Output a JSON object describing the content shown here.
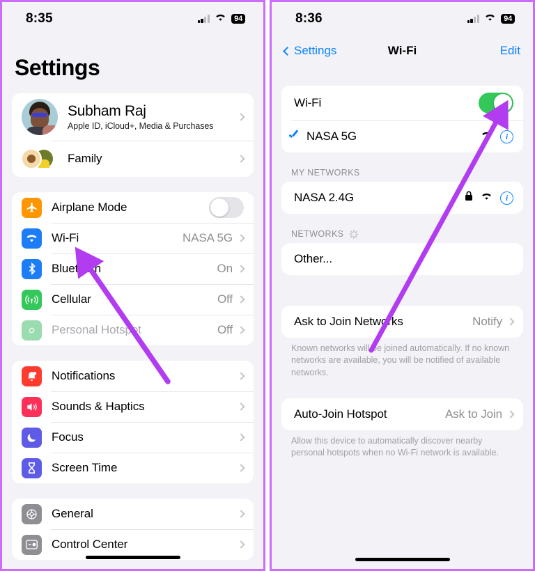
{
  "meta": {
    "accent_purple": "#cb6cfb",
    "ios_blue": "#0a84ff",
    "toggle_green": "#34c759"
  },
  "left_phone": {
    "status": {
      "time": "8:35",
      "battery": "94",
      "cellular_icon": "signal-bars-icon",
      "wifi_icon": "wifi-icon"
    },
    "title": "Settings",
    "profile": {
      "name": "Subham Raj",
      "subtitle": "Apple ID, iCloud+, Media & Purchases",
      "family_label": "Family"
    },
    "group_connectivity": [
      {
        "label": "Airplane Mode",
        "icon": "airplane-icon",
        "value": "",
        "control": "toggle-off"
      },
      {
        "label": "Wi-Fi",
        "icon": "wifi-icon",
        "value": "NASA 5G",
        "control": "chevron"
      },
      {
        "label": "Bluetooth",
        "icon": "bluetooth-icon",
        "value": "On",
        "control": "chevron"
      },
      {
        "label": "Cellular",
        "icon": "cellular-icon",
        "value": "Off",
        "control": "chevron"
      },
      {
        "label": "Personal Hotspot",
        "icon": "hotspot-icon",
        "value": "Off",
        "control": "chevron",
        "disabled": true
      }
    ],
    "group_alerts": [
      {
        "label": "Notifications",
        "icon": "notifications-icon",
        "value": "",
        "control": "chevron"
      },
      {
        "label": "Sounds & Haptics",
        "icon": "sounds-icon",
        "value": "",
        "control": "chevron"
      },
      {
        "label": "Focus",
        "icon": "focus-icon",
        "value": "",
        "control": "chevron"
      },
      {
        "label": "Screen Time",
        "icon": "screentime-icon",
        "value": "",
        "control": "chevron"
      }
    ],
    "group_system": [
      {
        "label": "General",
        "icon": "general-icon",
        "value": "",
        "control": "chevron"
      },
      {
        "label": "Control Center",
        "icon": "controlcenter-icon",
        "value": "",
        "control": "chevron"
      }
    ]
  },
  "right_phone": {
    "status": {
      "time": "8:36",
      "battery": "94",
      "cellular_icon": "signal-bars-icon",
      "wifi_icon": "wifi-icon"
    },
    "nav": {
      "back_label": "Settings",
      "title": "Wi-Fi",
      "edit_label": "Edit"
    },
    "wifi_group": {
      "toggle_label": "Wi-Fi",
      "toggle_state": "on",
      "connected_network": "NASA 5G"
    },
    "my_networks": {
      "header": "MY NETWORKS",
      "items": [
        {
          "ssid": "NASA 2.4G",
          "locked": true
        }
      ]
    },
    "networks": {
      "header": "NETWORKS",
      "scanning": true,
      "items": [
        {
          "ssid": "Other..."
        }
      ]
    },
    "ask_to_join": {
      "label": "Ask to Join Networks",
      "value": "Notify",
      "footer": "Known networks will be joined automatically. If no known networks are available, you will be notified of available networks."
    },
    "auto_join_hotspot": {
      "label": "Auto-Join Hotspot",
      "value": "Ask to Join",
      "footer": "Allow this device to automatically discover nearby personal hotspots when no Wi-Fi network is available."
    }
  }
}
